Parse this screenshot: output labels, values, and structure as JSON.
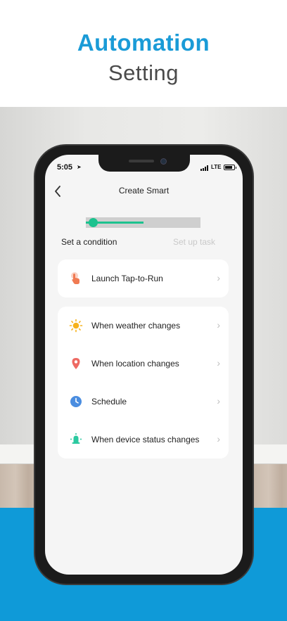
{
  "promo": {
    "headline": "Automation",
    "subheadline": "Setting"
  },
  "status_bar": {
    "time": "5:05",
    "network": "LTE"
  },
  "nav": {
    "back_icon": "chevron-left-icon",
    "title": "Create Smart"
  },
  "progress": {
    "fraction": 0.5,
    "steps": [
      "Set a condition",
      "Set up task"
    ],
    "active_step": 0
  },
  "colors": {
    "brand_blue": "#1a9bd7",
    "accent_green": "#1cc28e"
  },
  "conditions": {
    "primary": {
      "label": "Launch Tap-to-Run",
      "icon": "tap-hand-icon"
    },
    "items": [
      {
        "label": "When weather changes",
        "icon": "sun-icon"
      },
      {
        "label": "When location changes",
        "icon": "location-pin-icon"
      },
      {
        "label": "Schedule",
        "icon": "clock-icon"
      },
      {
        "label": "When device status changes",
        "icon": "device-icon"
      }
    ]
  },
  "chevron_glyph": "›"
}
